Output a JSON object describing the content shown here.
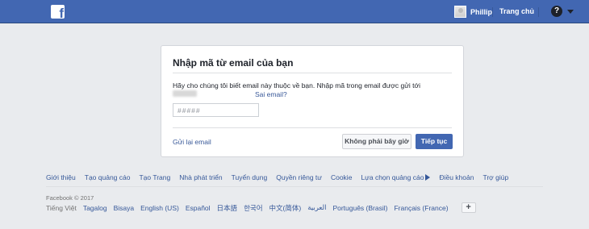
{
  "header": {
    "logo_letter": "f",
    "profile_name": "Phillip",
    "home_label": "Trang chủ",
    "help_glyph": "?"
  },
  "card": {
    "title": "Nhập mã từ email của bạn",
    "description": "Hãy cho chúng tôi biết email này thuộc về bạn. Nhập mã trong email được gửi tới",
    "wrong_email_link": "Sai email?",
    "code_placeholder": "#####",
    "resend_link": "Gửi lại email",
    "not_now_button": "Không phải bây giờ",
    "continue_button": "Tiếp tục"
  },
  "footer": {
    "links": [
      "Giới thiệu",
      "Tạo quảng cáo",
      "Tạo Trang",
      "Nhà phát triển",
      "Tuyển dụng",
      "Quyền riêng tư",
      "Cookie",
      "Lựa chọn quảng cáo",
      "Điều khoản",
      "Trợ giúp"
    ],
    "copyright": "Facebook © 2017",
    "languages": [
      "Tiếng Việt",
      "Tagalog",
      "Bisaya",
      "English (US)",
      "Español",
      "日本語",
      "한국어",
      "中文(简体)",
      "العربية",
      "Português (Brasil)",
      "Français (France)"
    ],
    "more_languages_glyph": "+"
  },
  "colors": {
    "brand_blue": "#4267b2",
    "link_blue": "#385898",
    "page_background": "#e9ebee"
  },
  "icons": {
    "logo": "facebook-f-icon",
    "help": "question-circle-icon",
    "menu": "caret-down-icon",
    "adchoices": "adchoices-triangle-icon"
  }
}
